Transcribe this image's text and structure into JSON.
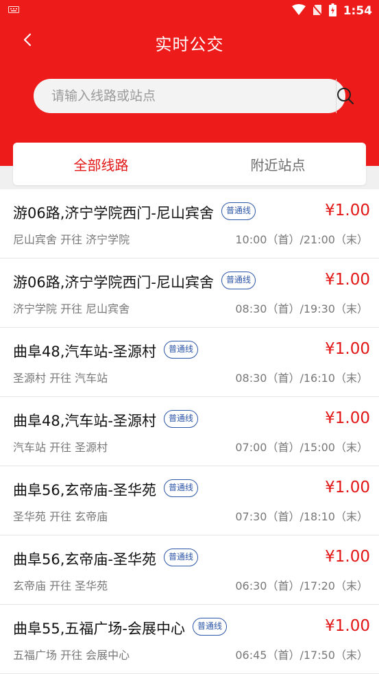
{
  "status_bar": {
    "left_icon": "keyboard-icon",
    "time": "1:54"
  },
  "nav": {
    "title": "实时公交",
    "back_label": "<"
  },
  "search": {
    "placeholder": "请输入线路或站点"
  },
  "tabs": [
    {
      "label": "全部线路",
      "active": true
    },
    {
      "label": "附近站点",
      "active": false
    }
  ],
  "routes": [
    {
      "name": "游06路,济宁学院西门-尼山宾舍",
      "badge": "普通线",
      "price": "¥1.00",
      "direction": "尼山宾舍 开往 济宁学院",
      "hours": "10:00（首）/21:00（末）"
    },
    {
      "name": "游06路,济宁学院西门-尼山宾舍",
      "badge": "普通线",
      "price": "¥1.00",
      "direction": "济宁学院 开往 尼山宾舍",
      "hours": "08:30（首）/19:30（末）"
    },
    {
      "name": "曲阜48,汽车站-圣源村",
      "badge": "普通线",
      "price": "¥1.00",
      "direction": "圣源村 开往 汽车站",
      "hours": "08:30（首）/16:10（末）"
    },
    {
      "name": "曲阜48,汽车站-圣源村",
      "badge": "普通线",
      "price": "¥1.00",
      "direction": "汽车站 开往 圣源村",
      "hours": "07:00（首）/15:00（末）"
    },
    {
      "name": "曲阜56,玄帝庙-圣华苑",
      "badge": "普通线",
      "price": "¥1.00",
      "direction": "圣华苑 开往 玄帝庙",
      "hours": "07:30（首）/18:10（末）"
    },
    {
      "name": "曲阜56,玄帝庙-圣华苑",
      "badge": "普通线",
      "price": "¥1.00",
      "direction": "玄帝庙 开往 圣华苑",
      "hours": "06:30（首）/17:20（末）"
    },
    {
      "name": "曲阜55,五福广场-会展中心",
      "badge": "普通线",
      "price": "¥1.00",
      "direction": "五福广场 开往 会展中心",
      "hours": "06:45（首）/17:50（末）"
    }
  ],
  "colors": {
    "brand_red": "#ee1b1b",
    "price_red": "#e31414",
    "badge_blue": "#2b55a8"
  }
}
